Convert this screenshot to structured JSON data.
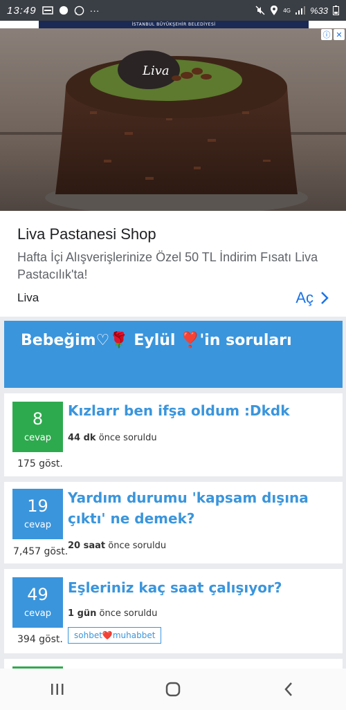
{
  "status": {
    "time": "13:49",
    "network": "4G",
    "battery": "%33"
  },
  "ad": {
    "top_strip": "İSTANBUL BÜYÜKŞEHİR BELEDİYESİ",
    "logo_text": "Liva",
    "title": "Liva Pastanesi Shop",
    "description": "Hafta İçi Alışverişlerinize Özel 50 TL İndirim Fısatı Liva Pastacılık'ta!",
    "brand": "Liva",
    "open_label": "Aç",
    "info_icon": "info-icon",
    "close_icon": "close-icon"
  },
  "header": {
    "title": "Bebeğim♡🌹 Eylül ❣️'in soruları"
  },
  "questions": [
    {
      "count": "8",
      "count_label": "cevap",
      "views": "175 göst.",
      "title": "Kızlarr ben ifşa oldum :Dkdk",
      "time_bold": "44 dk",
      "time_rest": " önce soruldu",
      "color": "#2eaa4e"
    },
    {
      "count": "19",
      "count_label": "cevap",
      "views": "7,457 göst.",
      "title": "Yardım durumu 'kapsam dışına çıktı' ne demek?",
      "time_bold": "20 saat",
      "time_rest": " önce soruldu",
      "color": "#3a95dc"
    },
    {
      "count": "49",
      "count_label": "cevap",
      "views": "394 göst.",
      "title": "Eşleriniz kaç saat çalışıyor?",
      "time_bold": "1 gün",
      "time_rest": " önce soruldu",
      "tag": "sohbet❤️muhabbet",
      "color": "#3a95dc"
    }
  ],
  "nav": {
    "recents_icon": "recents-icon",
    "home_icon": "home-icon",
    "back_icon": "back-icon"
  }
}
